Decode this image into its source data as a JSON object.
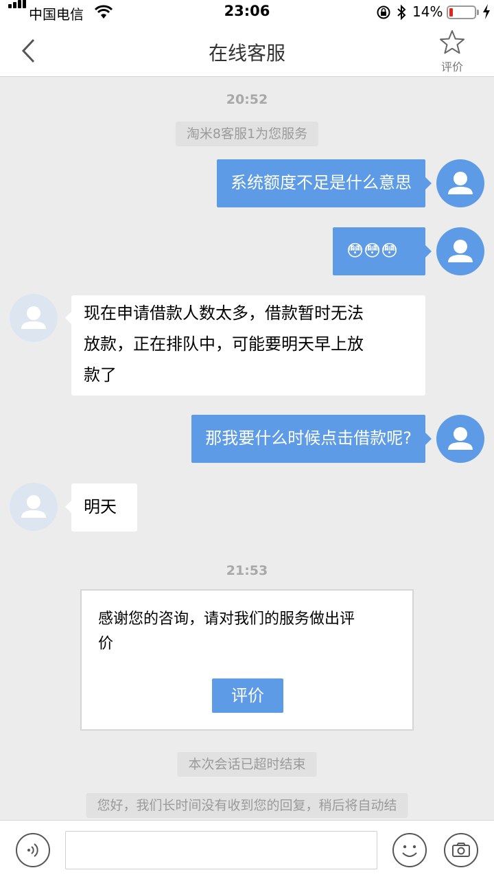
{
  "status_bar": {
    "carrier": "中国电信",
    "time": "23:06",
    "battery": "14%",
    "battery_level": 0.14
  },
  "header": {
    "back_icon": "chevron-left-icon",
    "title": "在线客服",
    "rate_icon": "star-outline-icon",
    "rate_label": "评价"
  },
  "chat": {
    "timestamp_1": "20:52",
    "service_notice": "淘米8客服1为您服务",
    "messages": [
      {
        "from": "user",
        "text": "系统额度不足是什么意思"
      },
      {
        "from": "user",
        "text": "😳😳😳"
      },
      {
        "from": "agent",
        "lines": [
          "现在申请借款人数太多，借款暂时无法",
          "放款，正在排队中，可能要明天早上放",
          "款了"
        ]
      },
      {
        "from": "user",
        "text": "那我要什么时候点击借款呢?"
      },
      {
        "from": "agent",
        "text": "明天"
      }
    ],
    "timestamp_2": "21:53",
    "rating_card": {
      "lines": [
        "感谢您的咨询，请对我们的服务做出评",
        "价"
      ],
      "button": "评价"
    },
    "session_timeout": "本次会话已超时结束",
    "auto_end_notice": "您好，我们长时间没有收到您的回复，稍后将自动结"
  },
  "input_bar": {
    "voice_icon": "voice-icon",
    "emoji_icon": "smiley-icon",
    "camera_icon": "camera-icon",
    "text_value": ""
  },
  "colors": {
    "accent": "#5d9be6",
    "chat_background": "#ececec",
    "agent_avatar": "#dde6f0"
  }
}
